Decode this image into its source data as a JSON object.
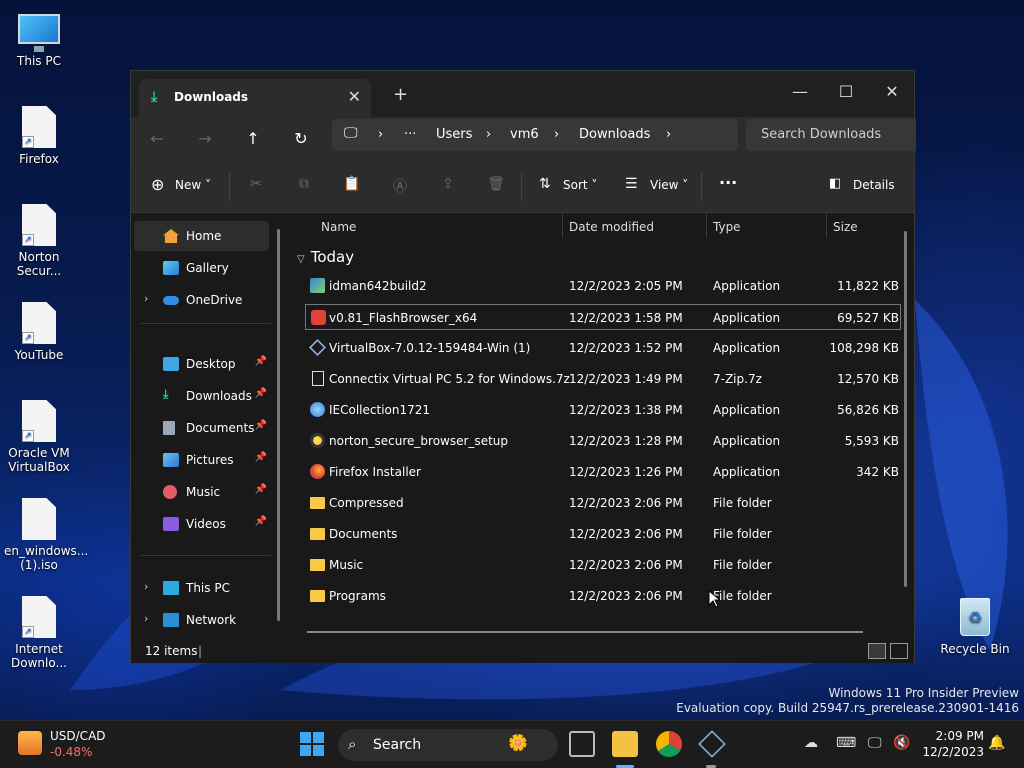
{
  "desktop": {
    "icons": [
      {
        "label": "This PC"
      },
      {
        "label": "Firefox"
      },
      {
        "label": "Norton Secur..."
      },
      {
        "label": "YouTube"
      },
      {
        "label": "Oracle VM VirtualBox"
      },
      {
        "label": "en_windows... (1).iso"
      },
      {
        "label": "Internet Downlo..."
      }
    ],
    "recycle_bin": "Recycle Bin",
    "watermark": {
      "line1": "Windows 11 Pro Insider Preview",
      "line2": "Evaluation copy. Build 25947.rs_prerelease.230901-1416"
    }
  },
  "explorer": {
    "tab_title": "Downloads",
    "breadcrumb": [
      "Users",
      "vm6",
      "Downloads"
    ],
    "search_placeholder": "Search Downloads",
    "toolbar": {
      "new": "New",
      "sort": "Sort",
      "view": "View",
      "details": "Details"
    },
    "sidebar": {
      "home": "Home",
      "gallery": "Gallery",
      "onedrive": "OneDrive",
      "desktop": "Desktop",
      "downloads": "Downloads",
      "documents": "Documents",
      "pictures": "Pictures",
      "music": "Music",
      "videos": "Videos",
      "this_pc": "This PC",
      "network": "Network"
    },
    "columns": {
      "name": "Name",
      "date": "Date modified",
      "type": "Type",
      "size": "Size"
    },
    "group": "Today",
    "files": [
      {
        "name": "idman642build2",
        "date": "12/2/2023 2:05 PM",
        "type": "Application",
        "size": "11,822 KB",
        "icon": "idm-icon"
      },
      {
        "name": "v0.81_FlashBrowser_x64",
        "date": "12/2/2023 1:58 PM",
        "type": "Application",
        "size": "69,527 KB",
        "icon": "flash-icon"
      },
      {
        "name": "VirtualBox-7.0.12-159484-Win (1)",
        "date": "12/2/2023 1:52 PM",
        "type": "Application",
        "size": "108,298 KB",
        "icon": "virtualbox-icon"
      },
      {
        "name": "Connectix Virtual PC 5.2 for Windows.7z",
        "date": "12/2/2023 1:49 PM",
        "type": "7-Zip.7z",
        "size": "12,570 KB",
        "icon": "file-icon"
      },
      {
        "name": "IECollection1721",
        "date": "12/2/2023 1:38 PM",
        "type": "Application",
        "size": "56,826 KB",
        "icon": "ie-icon"
      },
      {
        "name": "norton_secure_browser_setup",
        "date": "12/2/2023 1:28 PM",
        "type": "Application",
        "size": "5,593 KB",
        "icon": "norton-icon"
      },
      {
        "name": "Firefox Installer",
        "date": "12/2/2023 1:26 PM",
        "type": "Application",
        "size": "342 KB",
        "icon": "firefox-icon"
      },
      {
        "name": "Compressed",
        "date": "12/2/2023 2:06 PM",
        "type": "File folder",
        "size": "",
        "icon": "folder-icon"
      },
      {
        "name": "Documents",
        "date": "12/2/2023 2:06 PM",
        "type": "File folder",
        "size": "",
        "icon": "folder-icon"
      },
      {
        "name": "Music",
        "date": "12/2/2023 2:06 PM",
        "type": "File folder",
        "size": "",
        "icon": "folder-icon"
      },
      {
        "name": "Programs",
        "date": "12/2/2023 2:06 PM",
        "type": "File folder",
        "size": "",
        "icon": "folder-icon"
      }
    ],
    "status": "12 items"
  },
  "taskbar": {
    "ticker_symbol": "USD/CAD",
    "ticker_change": "-0.48%",
    "search_label": "Search",
    "time": "2:09 PM",
    "date": "12/2/2023"
  },
  "colors": {
    "accent": "#0067c0",
    "folder": "#f7c947",
    "negative": "#ff6b6b"
  }
}
